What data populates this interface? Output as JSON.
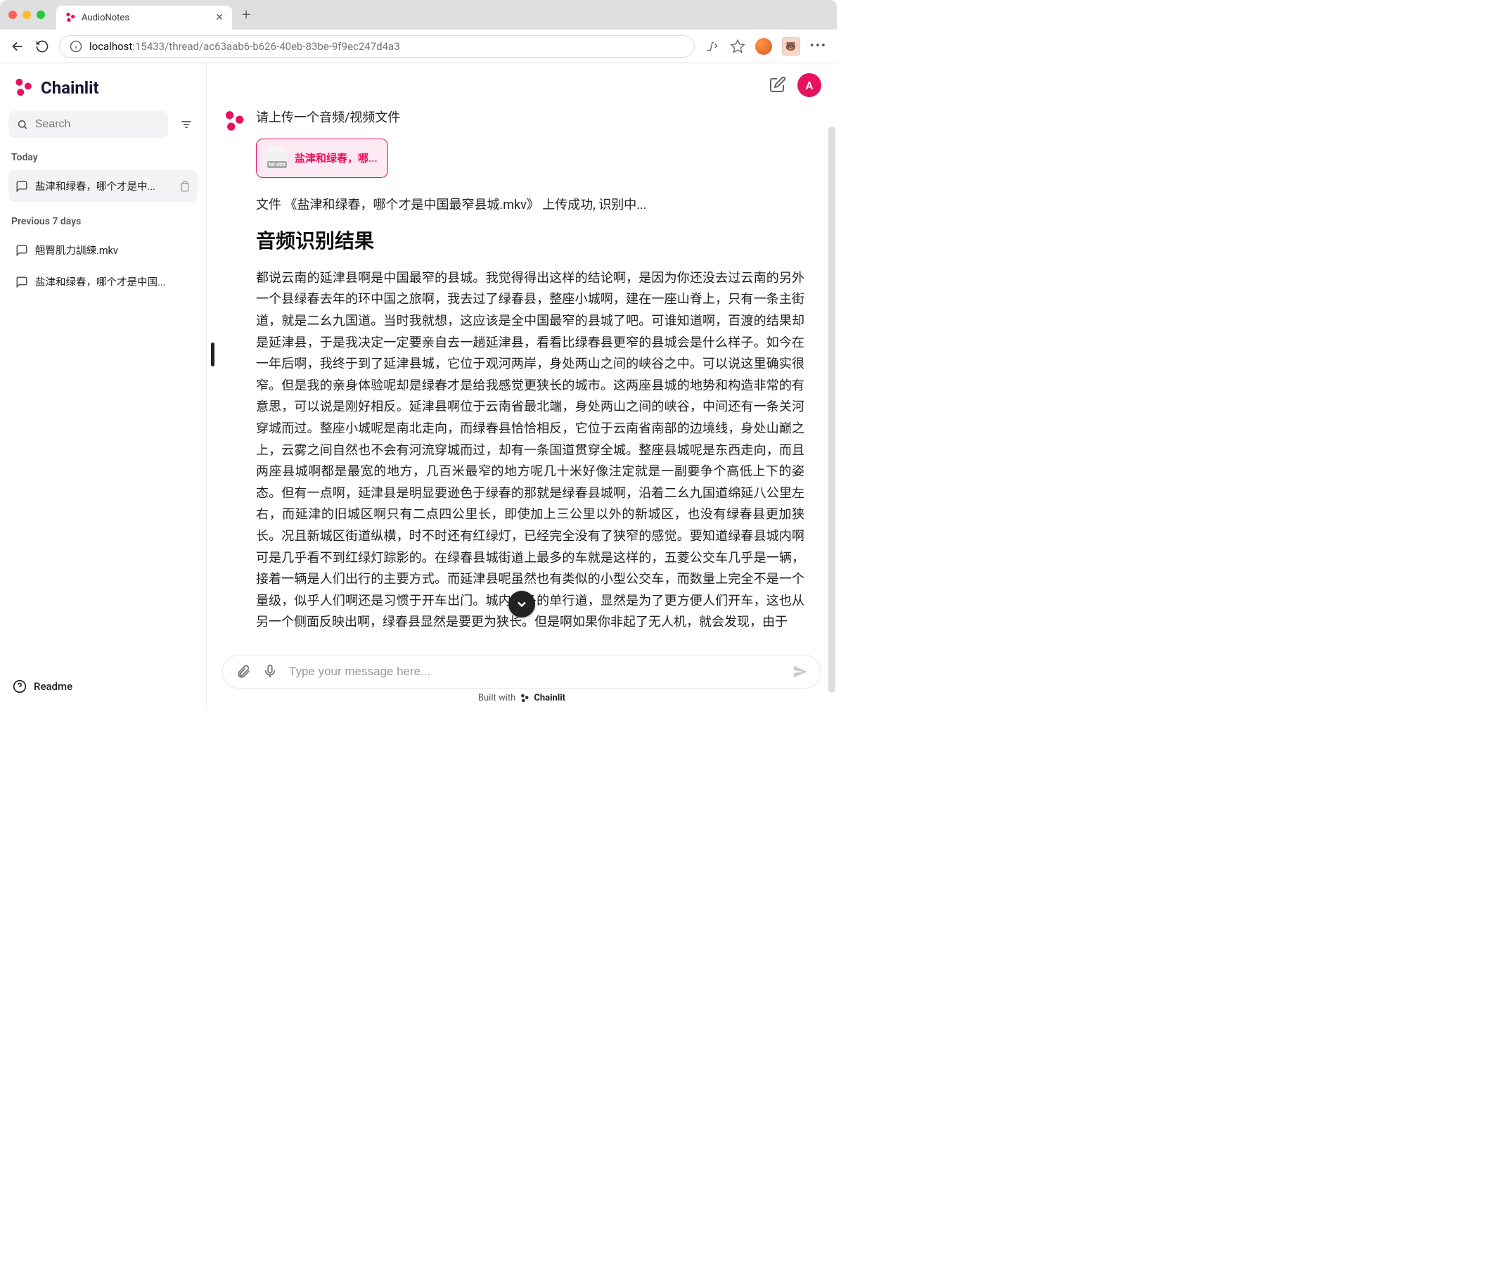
{
  "browser": {
    "tab_title": "AudioNotes",
    "host": "localhost",
    "port_and_path": ":15433/thread/ac63aab6-b626-40eb-83be-9f9ec247d4a3"
  },
  "brand": "Chainlit",
  "search": {
    "placeholder": "Search"
  },
  "sections": {
    "today": "Today",
    "prev7": "Previous 7 days"
  },
  "threads": {
    "today": [
      {
        "title": "盐津和绿春，哪个才是中..."
      }
    ],
    "prev7": [
      {
        "title": "翹臀肌力訓練.mkv"
      },
      {
        "title": "盐津和绿春，哪个才是中国..."
      }
    ]
  },
  "sidebar_footer": "Readme",
  "header": {
    "user_initial": "A"
  },
  "conversation": {
    "prompt": "请上传一个音频/视频文件",
    "file_chip": "盐津和绿春，哪...",
    "file_thumb_label": "tet-stre",
    "upload_status": "文件 《盐津和绿春，哪个才是中国最窄县城.mkv》 上传成功, 识别中...",
    "result_heading": "音频识别结果",
    "result_body": "都说云南的延津县啊是中国最窄的县城。我觉得得出这样的结论啊，是因为你还没去过云南的另外一个县绿春去年的环中国之旅啊，我去过了绿春县，整座小城啊，建在一座山脊上，只有一条主街道，就是二幺九国道。当时我就想，这应该是全中国最窄的县城了吧。可谁知道啊，百渡的结果却是延津县，于是我决定一定要亲自去一趟延津县，看看比绿春县更窄的县城会是什么样子。如今在一年后啊，我终于到了延津县城，它位于观河两岸，身处两山之间的峡谷之中。可以说这里确实很窄。但是我的亲身体验呢却是绿春才是给我感觉更狭长的城市。这两座县城的地势和构造非常的有意思，可以说是刚好相反。延津县啊位于云南省最北端，身处两山之间的峡谷，中间还有一条关河穿城而过。整座小城呢是南北走向，而绿春县恰恰相反，它位于云南省南部的边境线，身处山巅之上，云雾之间自然也不会有河流穿城而过，却有一条国道贯穿全城。整座县城呢是东西走向，而且两座县城啊都是最宽的地方，几百米最窄的地方呢几十米好像注定就是一副要争个高低上下的姿态。但有一点啊，延津县是明显要逊色于绿春的那就是绿春县城啊，沿着二幺九国道绵延八公里左右，而延津的旧城区啊只有二点四公里长，即使加上三公里以外的新城区，也没有绿春县更加狭长。况且新城区街道纵横，时不时还有红绿灯，已经完全没有了狭窄的感觉。要知道绿春县城内啊可是几乎看不到红绿灯踪影的。在绿春县城街道上最多的车就是这样的，五菱公交车几乎是一辆，接着一辆是人们出行的主要方式。而延津县呢虽然也有类似的小型公交车，而数量上完全不是一个量级，似乎人们啊还是习惯于开车出门。城内众多的单行道，显然是为了更方便人们开车，这也从另一个侧面反映出啊，绿春县显然是要更为狭长。但是啊如果你非起了无人机，就会发现，由于"
  },
  "composer": {
    "placeholder": "Type your message here..."
  },
  "footer": {
    "prefix": "Built with",
    "brand": "Chainlit"
  }
}
